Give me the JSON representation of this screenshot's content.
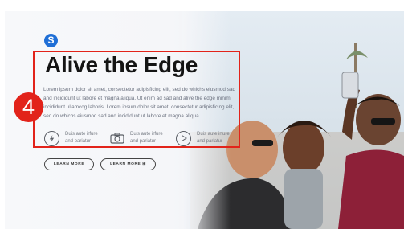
{
  "hero": {
    "logo_letter": "S",
    "title": "Alive the Edge",
    "body": "Lorem ipsum dolor sit amet, consectetur adipisficing elit, sed do whichs eiusmod sad and incididunt ut labore et magna aliqua. Ut enim ad sad and alive the edge minim incididunt ullamcog laboris. Lorem ipsum dolor sit amet, consectetur adipisficing elit, sed do whichs eiusmod sad and incididunt ut labore et magna aliqua.",
    "features": [
      {
        "icon": "bolt-circle-icon",
        "text": "Duis aute irfure and pariatur"
      },
      {
        "icon": "camera-icon",
        "text": "Duis aute irfure and pariatur"
      },
      {
        "icon": "play-icon",
        "text": "Duis aute irfure and pariatur"
      }
    ],
    "buttons": [
      {
        "label": "LEARN MORE"
      },
      {
        "label": "LEARN MORE ⊞"
      }
    ]
  },
  "annotation": {
    "badge_number": "4",
    "color": "#e2231a"
  },
  "colors": {
    "accent": "#1f6fd6",
    "title": "#141414",
    "annotation": "#e2231a"
  }
}
